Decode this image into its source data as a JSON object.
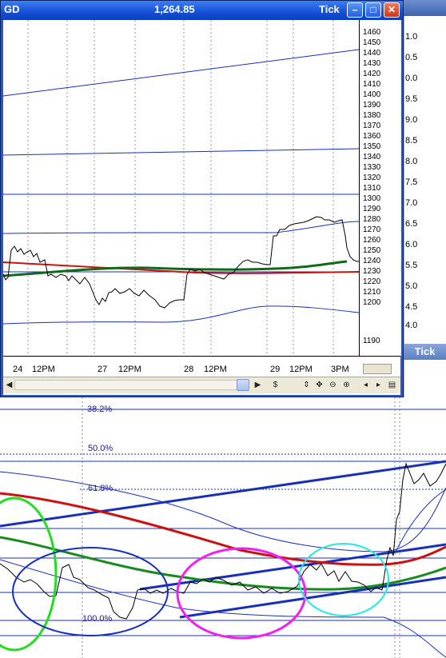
{
  "window": {
    "symbol": "GD",
    "price": "1,264.85",
    "mode": "Tick",
    "minimize_icon": "minimize-icon",
    "maximize_icon": "maximize-icon",
    "close_icon": "close-icon"
  },
  "background_window": {
    "mode": "Tick"
  },
  "y_axis": {
    "ticks": [
      "1460",
      "1450",
      "1440",
      "1430",
      "1420",
      "1410",
      "1400",
      "1390",
      "1380",
      "1370",
      "1360",
      "1350",
      "1340",
      "1330",
      "1320",
      "1310",
      "1300",
      "1290",
      "1280",
      "1270",
      "1260",
      "1250",
      "1240",
      "1230",
      "1220",
      "1210",
      "1200",
      "1190"
    ],
    "secondary_ticks": [
      "1.0",
      "0.5",
      "0.0",
      "9.5",
      "9.0",
      "8.5",
      "8.0",
      "7.5",
      "7.0",
      "6.5",
      "6.0",
      "5.5",
      "5.0",
      "4.5",
      "4.0"
    ]
  },
  "x_axis": {
    "labels": [
      "24",
      "12PM",
      "27",
      "12PM",
      "28",
      "12PM",
      "29",
      "12PM",
      "3PM"
    ]
  },
  "toolbar": {
    "icons": [
      "scroll-left-icon",
      "scroll-right-icon",
      "sync-icon",
      "updown-icon",
      "move-icon",
      "zoom-out-icon",
      "zoom-in-icon",
      "prev-icon",
      "next-icon",
      "options-icon"
    ],
    "glyphs": [
      "◀",
      "▶",
      "$",
      "⇕",
      "✥",
      "⊖",
      "⊕",
      "◂",
      "▸",
      "▤"
    ]
  },
  "fibonacci": {
    "levels": [
      "38.2%",
      "50.0%",
      "61.8%",
      "100.0%"
    ]
  },
  "colors": {
    "title_bar": "#1550d6",
    "price_line": "#000000",
    "ma_green": "#0f6b1a",
    "ma_red": "#cc1111",
    "band_blue": "#1a2fb8",
    "circle_green": "#22dd22",
    "circle_blue": "#1a2fb8",
    "circle_magenta": "#ee22ee",
    "circle_cyan": "#22e8e8"
  }
}
